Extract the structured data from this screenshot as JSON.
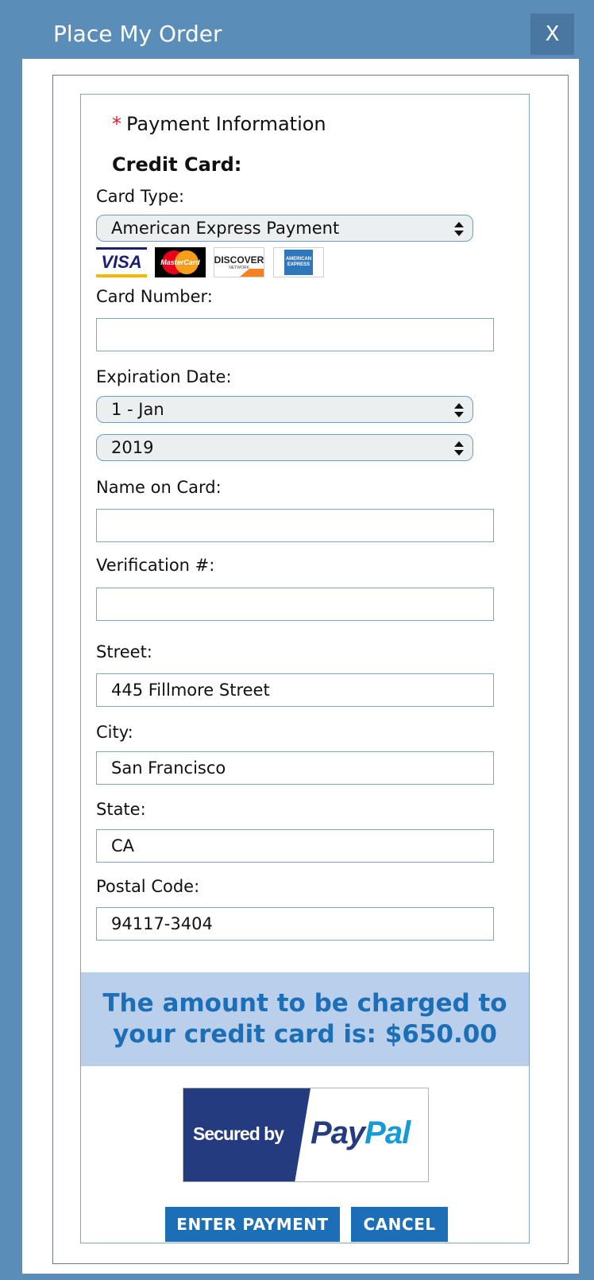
{
  "window": {
    "title": "Place My Order",
    "close_label": "X"
  },
  "form": {
    "required_marker": "*",
    "payment_heading": "Payment Information",
    "credit_card_heading": "Credit Card:",
    "card_type": {
      "label": "Card Type:",
      "selected": "American Express Payment"
    },
    "card_logos": [
      {
        "name": "visa",
        "text": "VISA"
      },
      {
        "name": "mastercard",
        "text": "MasterCard"
      },
      {
        "name": "discover",
        "text": "DISCOVER",
        "subtext": "NETWORK"
      },
      {
        "name": "american-express",
        "text": "AMERICAN EXPRESS"
      }
    ],
    "card_number": {
      "label": "Card Number:",
      "value": ""
    },
    "expiration": {
      "label": "Expiration Date:",
      "month_selected": "1 - Jan",
      "year_selected": "2019"
    },
    "name_on_card": {
      "label": "Name on Card:",
      "value": ""
    },
    "verification": {
      "label": "Verification #:",
      "value": ""
    },
    "street": {
      "label": "Street:",
      "value": "445 Fillmore Street"
    },
    "city": {
      "label": "City:",
      "value": "San Francisco"
    },
    "state": {
      "label": "State:",
      "value": "CA"
    },
    "postal_code": {
      "label": "Postal Code:",
      "value": "94117-3404"
    }
  },
  "amount_notice": {
    "line1": "The amount to be charged to",
    "line2": "your credit card is: $650.00"
  },
  "paypal_badge": {
    "secured_text": "Secured by",
    "brand_pay": "Pay",
    "brand_pal": "Pal"
  },
  "buttons": {
    "enter_payment": "ENTER PAYMENT",
    "cancel": "CANCEL"
  },
  "colors": {
    "frame_blue": "#5b8db9",
    "accent_blue": "#1c6fb7",
    "banner_bg": "#b9cfeb",
    "required_red": "#d4202a",
    "paypal_navy": "#253b80",
    "paypal_light": "#179bd7"
  }
}
